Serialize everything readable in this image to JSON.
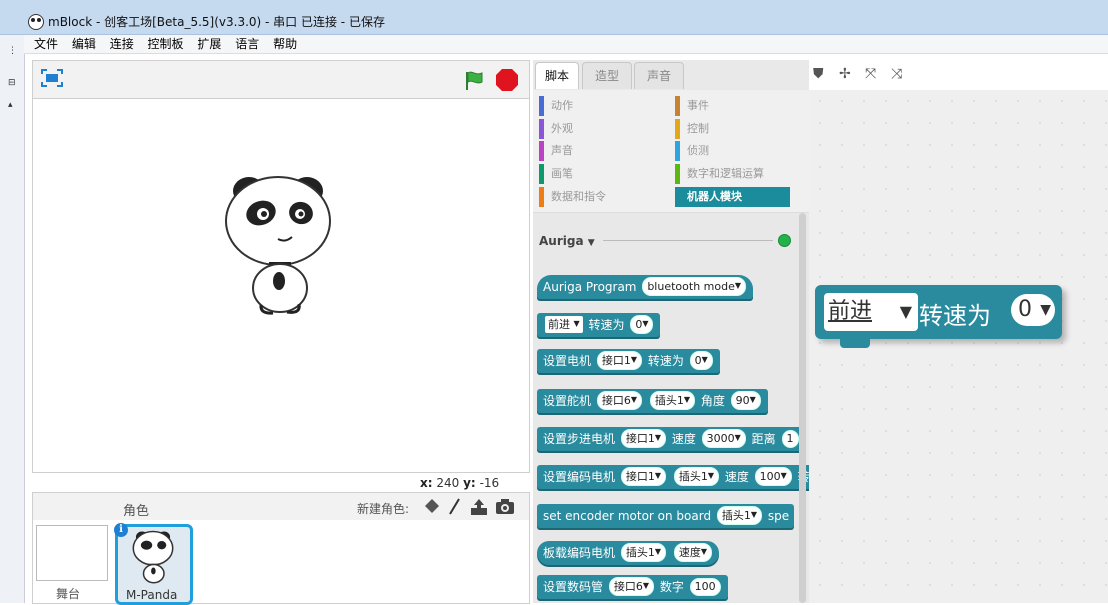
{
  "window": {
    "title": "mBlock - 创客工场[Beta_5.5](v3.3.0) - 串口 已连接 - 已保存"
  },
  "menu": [
    "文件",
    "编辑",
    "连接",
    "控制板",
    "扩展",
    "语言",
    "帮助"
  ],
  "stage": {
    "coords_x_label": "x:",
    "coords_x": "240",
    "coords_y_label": "y:",
    "coords_y": "-16"
  },
  "sprites": {
    "header_label": "角色",
    "new_sprite_label": "新建角色:",
    "stage_label": "舞台",
    "items": [
      {
        "name": "M-Panda",
        "selected": true
      }
    ]
  },
  "palette": {
    "tabs": [
      "脚本",
      "造型",
      "声音"
    ],
    "active_tab": "脚本",
    "categories": [
      {
        "label": "动作",
        "color": "#4a6cd4"
      },
      {
        "label": "事件",
        "color": "#c88330"
      },
      {
        "label": "外观",
        "color": "#8a55d7"
      },
      {
        "label": "控制",
        "color": "#e1a91a"
      },
      {
        "label": "声音",
        "color": "#bb42c3"
      },
      {
        "label": "侦测",
        "color": "#2ca5e2"
      },
      {
        "label": "画笔",
        "color": "#0e9a6c"
      },
      {
        "label": "数字和逻辑运算",
        "color": "#5cb712"
      },
      {
        "label": "数据和指令",
        "color": "#ee7d16"
      },
      {
        "label": "机器人模块",
        "color": "#1b8c9c",
        "selected": true
      }
    ],
    "device": "Auriga",
    "device_arrow": "▼",
    "blocks": {
      "b1": {
        "label": "Auriga Program",
        "mode": "bluetooth mode"
      },
      "b2": {
        "dir": "前进",
        "label": "转速为",
        "val": "0"
      },
      "b3": {
        "label": "设置电机",
        "port": "接口1",
        "label2": "转速为",
        "val": "0"
      },
      "b4": {
        "label": "设置舵机",
        "port": "接口6",
        "slot": "插头1",
        "label2": "角度",
        "val": "90"
      },
      "b5": {
        "label": "设置步进电机",
        "port": "接口1",
        "label2": "速度",
        "speed": "3000",
        "label3": "距离",
        "dist": "1"
      },
      "b6": {
        "label": "设置编码电机",
        "port": "接口1",
        "slot": "插头1",
        "label2": "速度",
        "val": "100",
        "label3": "转"
      },
      "b7": {
        "label": "set encoder motor on board",
        "slot": "插头1",
        "label2": "spe"
      },
      "b8": {
        "label": "板载编码电机",
        "slot": "插头1",
        "opt": "速度"
      },
      "b9": {
        "label": "设置数码管",
        "port": "接口6",
        "label2": "数字",
        "val": "100"
      }
    }
  },
  "script": {
    "block": {
      "dir": "前进",
      "label": "转速为",
      "val": "0"
    }
  },
  "colors": {
    "block": "#2a8b9f",
    "selection": "#1f9fdc"
  }
}
